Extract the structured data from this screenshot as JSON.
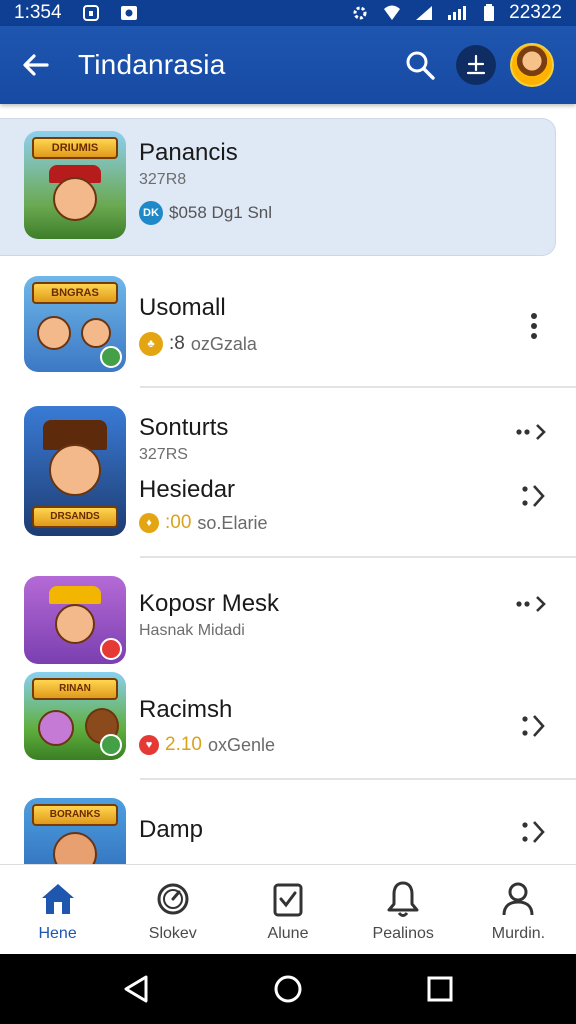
{
  "status_bar": {
    "time": "1:354",
    "right_text": "22322"
  },
  "app_bar": {
    "title": "Tindanrasia"
  },
  "items": [
    {
      "title": "Panancis",
      "subtitle": "327R8",
      "meta_badge": "DK",
      "meta_text": "$058 Dg1 Snl",
      "thumb_text": "DRIUMIS"
    },
    {
      "title": "Usomall",
      "meta_value": ":8",
      "meta_text": "ozGzala",
      "thumb_text": "BNGRAS"
    },
    {
      "title": "Sonturts",
      "subtitle": "327RS",
      "thumb_text": "DRSANDS"
    },
    {
      "title": "Hesiedar",
      "meta_value": ":00",
      "meta_text": "so.Elarie"
    },
    {
      "title": "Koposr Mesk",
      "subtitle": "Hasnak Midadi"
    },
    {
      "title": "Racimsh",
      "meta_value": "2.10",
      "meta_text": "oxGenle",
      "thumb_text": "RINAN"
    },
    {
      "title": "Damp",
      "thumb_text": "BORANKS"
    }
  ],
  "bottom_nav": [
    {
      "label": "Hene",
      "icon": "home-icon"
    },
    {
      "label": "Slokev",
      "icon": "compass-icon"
    },
    {
      "label": "Alune",
      "icon": "clipboard-check-icon"
    },
    {
      "label": "Pealinos",
      "icon": "bell-icon"
    },
    {
      "label": "Murdin.",
      "icon": "person-icon"
    }
  ],
  "colors": {
    "brand": "#1e56b0",
    "selected_bg": "#dfe8f5",
    "gold": "#d9a21b",
    "red": "#d32f2f"
  }
}
